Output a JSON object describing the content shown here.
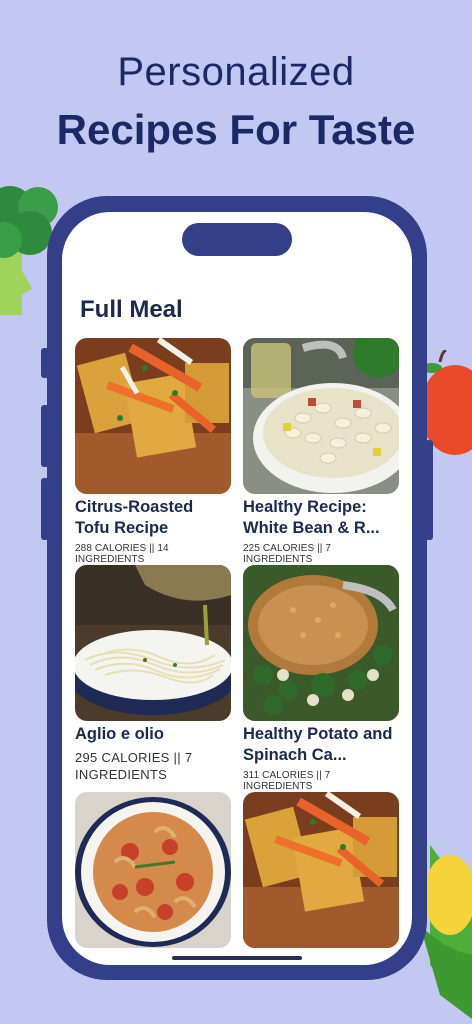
{
  "headline": {
    "line1": "Personalized",
    "line2": "Recipes For Taste"
  },
  "section": {
    "title": "Full Meal"
  },
  "recipes": [
    {
      "title": "Citrus-Roasted Tofu Recipe",
      "meta": "288 CALORIES || 14 INGREDIENTS",
      "image": "tofu-roasted-carrots"
    },
    {
      "title": "Healthy Recipe: White Bean & R...",
      "meta": "225 CALORIES || 7 INGREDIENTS",
      "image": "white-bean-salad"
    },
    {
      "title": "Aglio e olio",
      "meta": "295 CALORIES || 7 INGREDIENTS",
      "image": "spaghetti-olive-oil"
    },
    {
      "title": "Healthy Potato and Spinach Ca...",
      "meta": "311 CALORIES || 7 INGREDIENTS",
      "image": "potato-spinach-casserole"
    },
    {
      "title": "",
      "meta": "",
      "image": "fusilli-tomato-pasta"
    },
    {
      "title": "",
      "meta": "",
      "image": "tofu-roasted-carrots"
    }
  ],
  "colors": {
    "background": "#c3c8f2",
    "phone": "#343f8a",
    "heading": "#1b2a66"
  }
}
